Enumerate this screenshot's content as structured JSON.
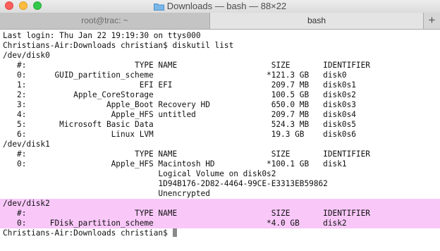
{
  "window": {
    "title": "Downloads — bash — 88×22",
    "title_icon": "folder-icon"
  },
  "tabs": [
    {
      "label": "root@trac: ~",
      "active": false
    },
    {
      "label": "bash",
      "active": true
    }
  ],
  "new_tab_label": "+",
  "terminal": {
    "lines": [
      "Last login: Thu Jan 22 19:19:30 on ttys000",
      "Christians-Air:Downloads christian$ diskutil list",
      "/dev/disk0",
      "   #:                       TYPE NAME                    SIZE       IDENTIFIER",
      "   0:      GUID_partition_scheme                        *121.3 GB   disk0",
      "   1:                        EFI EFI                     209.7 MB   disk0s1",
      "   2:          Apple_CoreStorage                         100.5 GB   disk0s2",
      "   3:                 Apple_Boot Recovery HD             650.0 MB   disk0s3",
      "   4:                  Apple_HFS untitled                209.7 MB   disk0s4",
      "   5:       Microsoft Basic Data                         524.3 MB   disk0s5",
      "   6:                  Linux LVM                         19.3 GB    disk0s6",
      "/dev/disk1",
      "   #:                       TYPE NAME                    SIZE       IDENTIFIER",
      "   0:                  Apple_HFS Macintosh HD           *100.1 GB   disk1",
      "                                 Logical Volume on disk0s2",
      "                                 1D94B176-2D82-4464-99CE-E3313EB59862",
      "                                 Unencrypted",
      "/dev/disk2",
      "   #:                       TYPE NAME                    SIZE       IDENTIFIER",
      "   0:     FDisk_partition_scheme                        *4.0 GB     disk2",
      "Christians-Air:Downloads christian$ "
    ],
    "highlighted_lines": [
      17,
      18,
      19
    ],
    "highlight_color": "#f9c8f9"
  }
}
